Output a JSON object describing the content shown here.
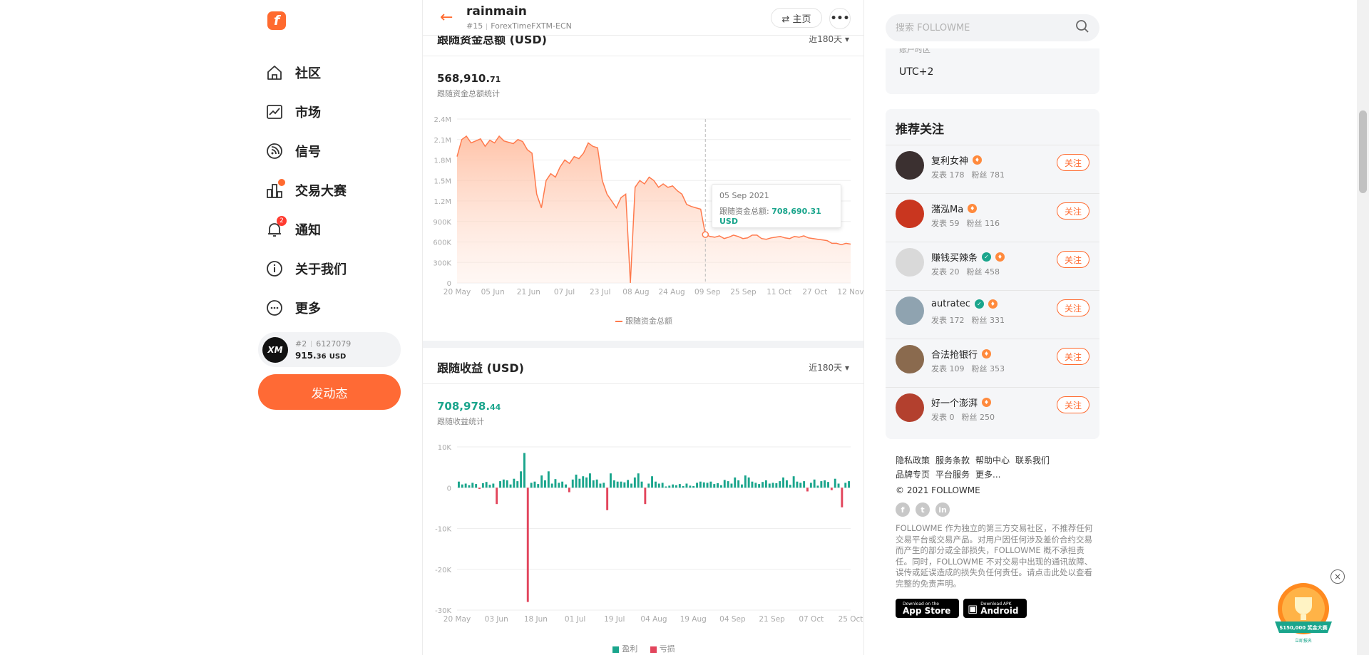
{
  "brand": {
    "logo": "f"
  },
  "nav": [
    {
      "label": "社区",
      "icon": "home-icon"
    },
    {
      "label": "市场",
      "icon": "chart-icon"
    },
    {
      "label": "信号",
      "icon": "rss-icon"
    },
    {
      "label": "交易大赛",
      "icon": "trophy-icon"
    },
    {
      "label": "通知",
      "icon": "bell-icon",
      "badge": "2"
    },
    {
      "label": "关于我们",
      "icon": "info-icon"
    },
    {
      "label": "更多",
      "icon": "more-icon"
    }
  ],
  "account": {
    "logo": "XM",
    "rank": "#2",
    "id": "6127079",
    "balance_main": "915.",
    "balance_dec": "36",
    "balance_unit": "USD"
  },
  "post_button": "发动态",
  "header": {
    "name": "rainmain",
    "rank": "#15",
    "server": "ForexTimeFXTM-ECN",
    "home_label": "⇄ 主页",
    "more_label": "•••"
  },
  "equity_card": {
    "title": "跟随资金总额 (USD)",
    "range": "近180天",
    "value_main": "568,910.",
    "value_dec": "71",
    "desc": "跟随资金总额统计",
    "legend": "跟随资金总额",
    "tooltip": {
      "date": "05 Sep 2021",
      "label": "跟随资金总额:",
      "value": "708,690.31 USD"
    }
  },
  "profit_card": {
    "title": "跟随收益 (USD)",
    "range": "近180天",
    "value_main": "708,978.",
    "value_dec": "44",
    "desc": "跟随收益统计",
    "legend_profit": "盈利",
    "legend_loss": "亏损"
  },
  "chart_data": [
    {
      "type": "area",
      "title": "跟随资金总额 (USD)",
      "ylim": [
        0,
        2400000
      ],
      "y_ticks": [
        "0",
        "300K",
        "600K",
        "900K",
        "1.2M",
        "1.5M",
        "1.8M",
        "2.1M",
        "2.4M"
      ],
      "x_ticks": [
        "20 May",
        "05 Jun",
        "21 Jun",
        "07 Jul",
        "23 Jul",
        "08 Aug",
        "24 Aug",
        "09 Sep",
        "25 Sep",
        "11 Oct",
        "27 Oct",
        "12 Nov"
      ],
      "series": [
        {
          "name": "跟随资金总额",
          "color": "#ff7a4d",
          "values": [
            1850000,
            2100000,
            2150000,
            2050000,
            2080000,
            2110000,
            2000000,
            2090000,
            2050000,
            2150000,
            2080000,
            2060000,
            2040000,
            2100000,
            2070000,
            1950000,
            1900000,
            1300000,
            1100000,
            1500000,
            1600000,
            1550000,
            1700000,
            1800000,
            1750000,
            1850000,
            1820000,
            1900000,
            2050000,
            2000000,
            1980000,
            1500000,
            1300000,
            1200000,
            1100000,
            1250000,
            1300000,
            0,
            1400000,
            1500000,
            1450000,
            1550000,
            1500000,
            1400000,
            1450000,
            1400000,
            1420000,
            1350000,
            1300000,
            1150000,
            1120000,
            1100000,
            1080000,
            708690,
            680000,
            670000,
            690000,
            650000,
            670000,
            700000,
            680000,
            650000,
            660000,
            700000,
            700000,
            650000,
            640000,
            660000,
            670000,
            680000,
            660000,
            650000,
            680000,
            670000,
            690000,
            660000,
            650000,
            640000,
            630000,
            620000,
            580000,
            580000,
            560000,
            580000,
            568910
          ]
        }
      ]
    },
    {
      "type": "bar",
      "title": "跟随收益 (USD)",
      "ylim": [
        -30000,
        10000
      ],
      "y_ticks": [
        "-30K",
        "-20K",
        "-10K",
        "0",
        "10K"
      ],
      "x_ticks": [
        "20 May",
        "03 Jun",
        "18 Jun",
        "01 Jul",
        "19 Jul",
        "04 Aug",
        "19 Aug",
        "04 Sep",
        "21 Sep",
        "07 Oct",
        "25 Oct"
      ],
      "series": [
        {
          "name": "盈利",
          "color": "#1aa58c"
        },
        {
          "name": "亏损",
          "color": "#e2455c"
        }
      ],
      "values": [
        1500,
        800,
        1000,
        600,
        1200,
        900,
        -300,
        1100,
        1400,
        700,
        1000,
        -4000,
        1600,
        2000,
        1800,
        800,
        2200,
        1600,
        4000,
        8500,
        -28000,
        1200,
        1500,
        900,
        3000,
        1800,
        4000,
        1000,
        2100,
        1200,
        1500,
        800,
        -1100,
        2000,
        3200,
        2200,
        2800,
        2500,
        3500,
        1800,
        2000,
        1000,
        1200,
        -5500,
        3500,
        1800,
        1500,
        1500,
        1300,
        1900,
        1000,
        2500,
        3500,
        1500,
        -4000,
        1000,
        2800,
        1500,
        1000,
        1200,
        300,
        500,
        800,
        600,
        900,
        400,
        1000,
        500,
        400,
        1200,
        1500,
        1300,
        1200,
        1500,
        900,
        1100,
        600,
        1900,
        1600,
        1000,
        2500,
        1800,
        800,
        3000,
        2500,
        1500,
        1200,
        900,
        1400,
        1800,
        1000,
        1200,
        1100,
        1600,
        2500,
        1800,
        700,
        2800,
        1500,
        1200,
        1600,
        -900,
        1200,
        2000,
        500,
        1600,
        1800,
        1400,
        -600,
        2200,
        1000,
        -4800,
        1200,
        1600
      ]
    }
  ],
  "search": {
    "placeholder": "搜索 FOLLOWME"
  },
  "timezone": {
    "label_cut": "账户时区",
    "value": "UTC+2"
  },
  "recommend": {
    "title": "推荐关注",
    "follow_label": "关注",
    "users": [
      {
        "name": "复利女神",
        "posts_label": "发表 178",
        "fans_label": "粉丝 781",
        "avatar_color": "#3b3030",
        "verified": false
      },
      {
        "name": "潴泓Ma",
        "posts_label": "发表 59",
        "fans_label": "粉丝 116",
        "avatar_color": "#c9361f",
        "verified": false
      },
      {
        "name": "赚钱买辣条",
        "posts_label": "发表 20",
        "fans_label": "粉丝 458",
        "avatar_color": "#d9d9d9",
        "verified": true
      },
      {
        "name": "autratec",
        "posts_label": "发表 172",
        "fans_label": "粉丝 331",
        "avatar_color": "#8fa3b0",
        "verified": true
      },
      {
        "name": "合法抢银行",
        "posts_label": "发表 109",
        "fans_label": "粉丝 353",
        "avatar_color": "#8a6a4e",
        "verified": false
      },
      {
        "name": "好一个澎湃",
        "posts_label": "发表 0",
        "fans_label": "粉丝 250",
        "avatar_color": "#b3402e",
        "verified": false
      }
    ]
  },
  "footer": {
    "links_row1": [
      "隐私政策",
      "服务条款",
      "帮助中心",
      "联系我们"
    ],
    "links_row2": [
      "品牌专页",
      "平台服务",
      "更多..."
    ],
    "copyright": "© 2021 FOLLOWME",
    "social": [
      "f",
      "t",
      "in"
    ],
    "disclaimer": "FOLLOWME 作为独立的第三方交易社区，不推荐任何交易平台或交易产品。对用户因任何涉及差价合约交易而产生的部分或全部损失，FOLLOWME 概不承担责任。同时，FOLLOWME 不对交易中出现的通讯故障、误传或延误造成的损失负任何责任。请点击此处以查看完整的免责声明。",
    "app_store": {
      "small": "Download on the",
      "big": "App Store"
    },
    "android": {
      "small": "Download APK",
      "big": "Android"
    }
  },
  "promo": {
    "text": "$150,000 奖金大赛",
    "sub": "立即报名"
  }
}
